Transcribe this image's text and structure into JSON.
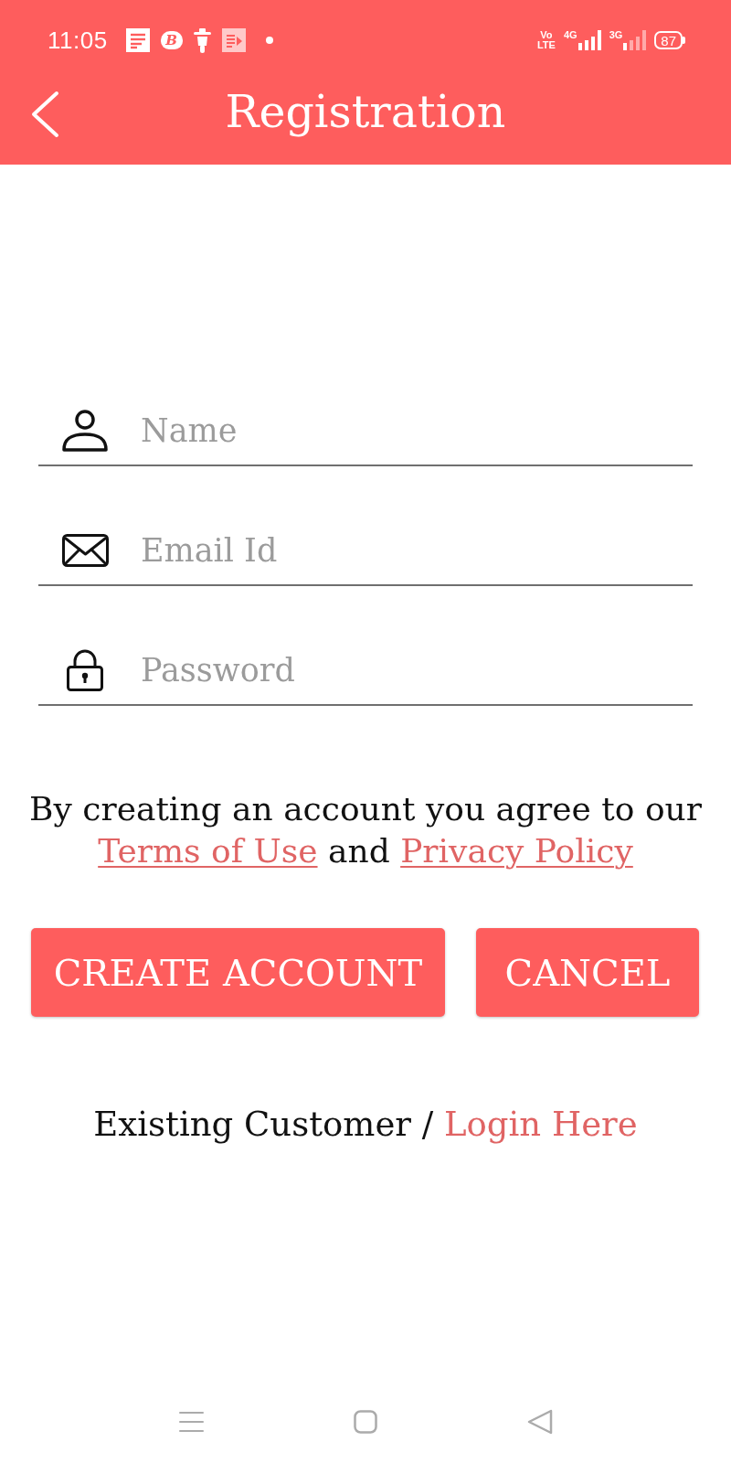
{
  "status_bar": {
    "time": "11:05",
    "notifications": [
      {
        "kind": "document"
      },
      {
        "kind": "badge",
        "letter": "B"
      },
      {
        "kind": "scooter"
      },
      {
        "kind": "video"
      },
      {
        "kind": "dot"
      }
    ],
    "volte": "Vo LTE",
    "networks": [
      {
        "label": "4G",
        "active": true
      },
      {
        "label": "3G",
        "active": false
      }
    ],
    "battery": "87"
  },
  "app_bar": {
    "title": "Registration"
  },
  "form": {
    "fields": [
      {
        "kind": "person",
        "placeholder": "Name"
      },
      {
        "kind": "email",
        "placeholder": "Email Id"
      },
      {
        "kind": "lock",
        "placeholder": "Password"
      }
    ]
  },
  "terms": {
    "text": "By creating an account you agree to our",
    "link_1": "Terms of Use",
    "joiner": "and",
    "link_2": "Privacy Policy"
  },
  "buttons": [
    "CREATE ACCOUNT",
    "CANCEL"
  ],
  "login": {
    "text": "Existing Customer /",
    "link": "Login Here"
  },
  "nav_bar": [
    {
      "kind": "menu"
    },
    {
      "kind": "home"
    },
    {
      "kind": "back"
    }
  ]
}
